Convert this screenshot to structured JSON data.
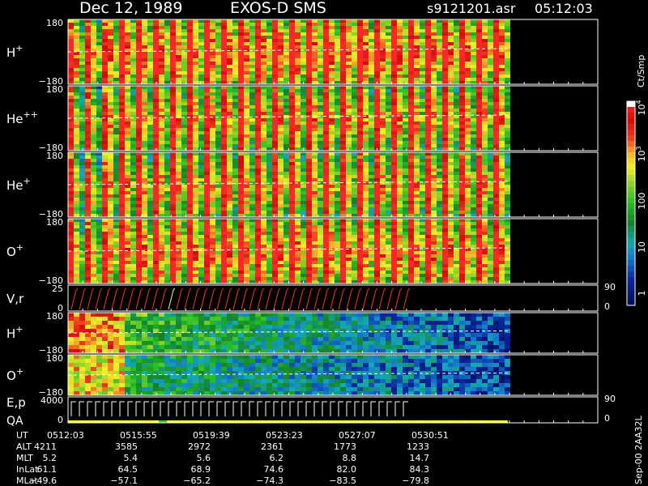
{
  "header": {
    "date": "Dec 12, 1989",
    "instrument": "EXOS-D SMS",
    "file": "s9121201.asr",
    "time": "05:12:03"
  },
  "colorbar": {
    "unit": "Ct/Smp",
    "ticks": [
      "1",
      "10",
      "100",
      "10",
      "10"
    ],
    "tick_exponents": [
      "",
      "",
      "",
      "3",
      "4"
    ],
    "scale": "log",
    "range": [
      1,
      10000
    ]
  },
  "footer_label": "Sep-00 2AA32L",
  "colors": {
    "background": "#000000",
    "frame": "#ffffff",
    "spectro_low": "#0a2a9a",
    "spectro_mid": "#28c828",
    "spectro_high": "#ff1a1a",
    "trace_red": "#ff3030",
    "trace_yellow": "#ffff40",
    "trace_white": "#ffffff",
    "status_green": "#20d020",
    "status_yellow": "#ffff20"
  },
  "chart_data": {
    "type": "heatmap",
    "x_label": "UT",
    "x_start": "05:12:03",
    "x_end": "05:30:51",
    "data_end_fraction": 0.83,
    "panels": [
      {
        "name": "H+",
        "label_base": "H",
        "label_sup": "+",
        "ymin": "−180",
        "ymax": "180",
        "kind": "spectrogram",
        "intensity": 0.82,
        "banding": 0.9
      },
      {
        "name": "He++",
        "label_base": "He",
        "label_sup": "++",
        "ymin": "−180",
        "ymax": "180",
        "kind": "spectrogram",
        "intensity": 0.7,
        "banding": 1.0
      },
      {
        "name": "He+",
        "label_base": "He",
        "label_sup": "+",
        "ymin": "−180",
        "ymax": "180",
        "kind": "spectrogram",
        "intensity": 0.68,
        "banding": 1.0
      },
      {
        "name": "O+",
        "label_base": "O",
        "label_sup": "+",
        "ymin": "−180",
        "ymax": "180",
        "kind": "spectrogram",
        "intensity": 0.78,
        "banding": 0.9
      },
      {
        "name": "V,r",
        "label_base": "V,r",
        "label_sup": "",
        "ymin": "0",
        "ymax": "25",
        "right_top": "90",
        "right_bottom": "0",
        "kind": "trace"
      },
      {
        "name": "H+",
        "label_base": "H",
        "label_sup": "+",
        "ymin": "−180",
        "ymax": "180",
        "kind": "pitch",
        "intensity": 0.35
      },
      {
        "name": "O+",
        "label_base": "O",
        "label_sup": "+",
        "ymin": "−180",
        "ymax": "180",
        "kind": "pitch",
        "intensity": 0.28
      },
      {
        "name": "E,p",
        "label_base": "E,p",
        "label_sup": "",
        "label2": "QA",
        "ymin": "0",
        "ymax": "4000",
        "right_top": "90",
        "right_bottom": "0",
        "kind": "steps"
      }
    ],
    "ephemeris": {
      "rows": [
        {
          "label": "UT",
          "values": [
            "0512:03",
            "0515:55",
            "0519:39",
            "0523:23",
            "0527:07",
            "0530:51"
          ]
        },
        {
          "label": "ALT",
          "values": [
            "4211",
            "3585",
            "2972",
            "2361",
            "1773",
            "1233"
          ]
        },
        {
          "label": "MLT",
          "values": [
            "5.2",
            "5.4",
            "5.6",
            "6.2",
            "8.8",
            "14.7"
          ]
        },
        {
          "label": "InLat",
          "values": [
            "61.1",
            "64.5",
            "68.9",
            "74.6",
            "82.0",
            "84.3"
          ]
        },
        {
          "label": "MLat",
          "values": [
            "−49.6",
            "−57.1",
            "−65.2",
            "−74.3",
            "−83.5",
            "−79.8"
          ]
        }
      ]
    }
  }
}
